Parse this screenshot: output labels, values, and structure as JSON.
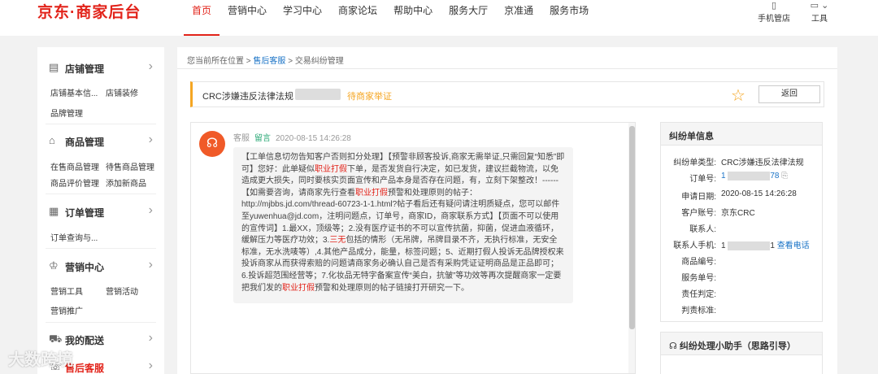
{
  "header": {
    "logo": "京东·商家后台",
    "nav": [
      "首页",
      "营销中心",
      "学习中心",
      "商家论坛",
      "帮助中心",
      "服务大厅",
      "京准通",
      "服务市场"
    ],
    "tools": [
      {
        "label": "手机管店",
        "icon": "phone-icon"
      },
      {
        "label": "工具",
        "icon": "tools-icon"
      }
    ]
  },
  "sidebar": {
    "sections": [
      {
        "title": "店铺管理",
        "icon": "store-icon",
        "items": [
          "店铺基本信...",
          "店铺装修",
          "品牌管理"
        ]
      },
      {
        "title": "商品管理",
        "icon": "bag-icon",
        "items": [
          "在售商品管理",
          "待售商品管理",
          "商品评价管理",
          "添加新商品"
        ]
      },
      {
        "title": "订单管理",
        "icon": "order-icon",
        "items": [
          "订单查询与..."
        ]
      },
      {
        "title": "营销中心",
        "icon": "crown-icon",
        "items": [
          "营销工具",
          "营销活动",
          "营销推广"
        ]
      },
      {
        "title": "我的配送",
        "icon": "truck-icon",
        "items": []
      },
      {
        "title": "售后客服",
        "icon": "service-icon",
        "items": []
      }
    ]
  },
  "breadcrumb": {
    "prefix": "您当前所在位置 >",
    "link": "售后客服",
    "sep": ">",
    "current": "交易纠纷管理"
  },
  "dispute": {
    "title": "CRC涉嫌违反法律法规",
    "status": "待商家举证",
    "back_label": "返回"
  },
  "message": {
    "sender": "客服",
    "tag": "留言",
    "time": "2020-08-15 14:26:28",
    "parts": [
      {
        "t": "【工单信息切勿告知客户否则扣分处理】【预警非顾客投诉,商家无需举证,只需回复“知悉”即可】您好：此单疑似",
        "red": false
      },
      {
        "t": "职业打假",
        "red": true
      },
      {
        "t": "下单，是否发货自行决定，如已发货，建议拦截物流，以免造成更大损失，同时要核实页面宣传和产品本身是否存在问题，有，立刻下架整改！------【如需要咨询，请商家先行查看",
        "red": false
      },
      {
        "t": "职业打假",
        "red": true
      },
      {
        "t": "预警和处理原则的帖子：http://mjbbs.jd.com/thread-60723-1-1.html?帖子看后还有疑问请注明质疑点，您可以邮件至yuwenhua@jd.com，注明问题点，订单号，商家ID，商家联系方式】【页面不可以使用的宣传词】1.最XX，顶级等；2.没有医疗证书的不可以宣传抗菌，抑菌，促进血液循环，缓解压力等医疗功效；3.",
        "red": false
      },
      {
        "t": "三无",
        "red": true
      },
      {
        "t": "包括的情形（无吊牌，吊牌目录不齐，无执行标准，无安全标准，无水洗唛等）,4.其他产品成分，能量，标签问题；5、近期打假人投诉无品牌授权来投诉商家从而获得索赔的问题请商家务必确认自己是否有采购凭证证明商品是正品即可；6.投诉超范围经营等；7.化妆品无特字备案宣传“美白，抗皱”等功效等再次提醒商家一定要把我们发的",
        "red": false
      },
      {
        "t": "职业打假",
        "red": true
      },
      {
        "t": "预警和处理原则的帖子链接打开研究一下。",
        "red": false
      }
    ]
  },
  "info": {
    "title": "纠纷单信息",
    "rows": [
      {
        "label": "纠纷单类型:",
        "value": "CRC涉嫌违反法律法规"
      },
      {
        "label": "订单号:",
        "value": "1",
        "suffix": "78",
        "masked": true,
        "link": true
      },
      {
        "label": "申请日期:",
        "value": "2020-08-15 14:26:28"
      },
      {
        "label": "客户账号:",
        "value": "京东CRC"
      },
      {
        "label": "联系人:",
        "value": ""
      },
      {
        "label": "联系人手机:",
        "value": "1",
        "suffix": "1",
        "masked": true,
        "extra": "查看电话"
      },
      {
        "label": "商品编号:",
        "value": ""
      },
      {
        "label": "服务单号:",
        "value": ""
      },
      {
        "label": "责任判定:",
        "value": ""
      },
      {
        "label": "判责标准:",
        "value": ""
      }
    ]
  },
  "helper": {
    "title": "纠纷处理小助手（思路引导）"
  },
  "watermark": "大数跨境"
}
